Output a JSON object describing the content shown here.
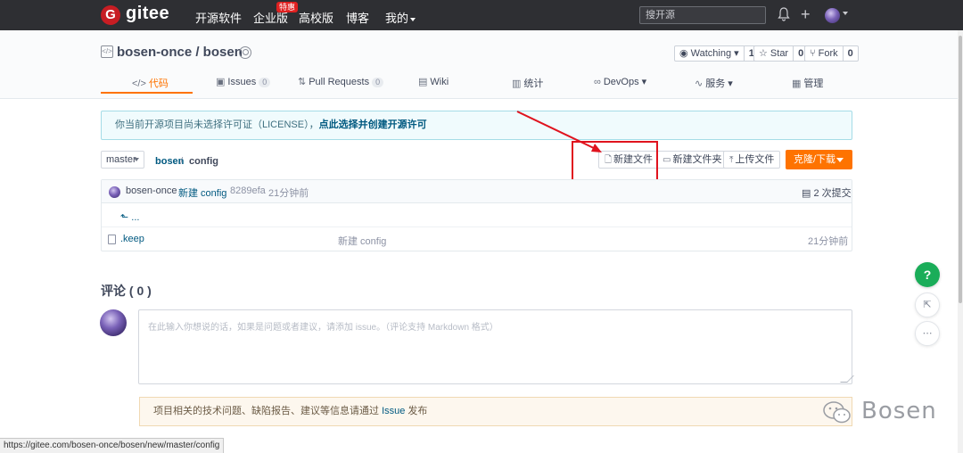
{
  "topnav": {
    "logo_letter": "G",
    "logo": "gitee",
    "links": [
      "开源软件",
      "企业版",
      "高校版",
      "博客",
      "我的"
    ],
    "enterprise_badge": "特惠",
    "search_placeholder": "搜开源"
  },
  "repo": {
    "title": "bosen-once / bosen",
    "watch_label": "Watching",
    "watch_count": "1",
    "star_label": "Star",
    "star_count": "0",
    "fork_label": "Fork",
    "fork_count": "0"
  },
  "tabs": [
    {
      "label": "代码",
      "icon": "code-icon"
    },
    {
      "label": "Issues",
      "count": "0",
      "icon": "issue-icon"
    },
    {
      "label": "Pull Requests",
      "count": "0",
      "icon": "pull-request-icon"
    },
    {
      "label": "Wiki",
      "icon": "wiki-icon"
    },
    {
      "label": "统计",
      "icon": "chart-icon"
    },
    {
      "label": "DevOps",
      "icon": "infinity-icon"
    },
    {
      "label": "服务",
      "icon": "pulse-icon"
    },
    {
      "label": "管理",
      "icon": "settings-icon"
    }
  ],
  "license": {
    "text": "你当前开源项目尚未选择许可证（LICENSE），",
    "link": "点此选择并创建开源许可"
  },
  "branch": "master",
  "breadcrumb": {
    "repo": "bosen",
    "sep": "/",
    "dir": "config"
  },
  "toolbar": {
    "new_file": "新建文件",
    "new_folder": "新建文件夹",
    "upload": "上传文件",
    "clone": "克隆/下载"
  },
  "commit": {
    "author": "bosen-once",
    "message": "新建 config",
    "hash": "8289efa",
    "time": "21分钟前",
    "commits_label": "2 次提交"
  },
  "files": {
    "parent": "...",
    "rows": [
      {
        "name": ".keep",
        "message": "新建 config",
        "time": "21分钟前"
      }
    ]
  },
  "comments": {
    "title": "评论 ( 0 )",
    "placeholder": "在此输入你想说的话，如果是问题或者建议，请添加 issue。（评论支持 Markdown 格式）",
    "notice_text": "项目相关的技术问题、缺陷报告、建议等信息请通过",
    "notice_link": "Issue",
    "notice_suffix": "发布"
  },
  "floating": {
    "help": "?"
  },
  "watermark": "Bosen",
  "status_url": "https://gitee.com/bosen-once/bosen/new/master/config",
  "colors": {
    "accent": "#fe7300",
    "nav_bg": "#2e2f33",
    "link": "#005980",
    "highlight": "#e0131e",
    "help": "#1aad59"
  }
}
